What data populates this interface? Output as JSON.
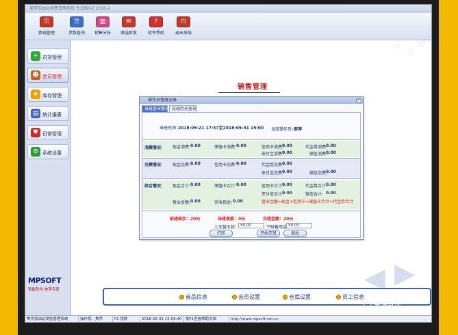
{
  "window": {
    "title": "美萍加油站销售管理系统 专业版(V) 2018-2"
  },
  "toolbar": [
    {
      "label": "换班管理",
      "icon": "key-icon",
      "color": "#c0392b"
    },
    {
      "label": "参数查询",
      "icon": "document-icon",
      "color": "#3a6fc4"
    },
    {
      "label": "销售分析",
      "icon": "chart-icon",
      "color": "#d04a8a"
    },
    {
      "label": "赠送群发",
      "icon": "gift-icon",
      "color": "#c0392b"
    },
    {
      "label": "软件帮助",
      "icon": "help-icon",
      "color": "#d03030"
    },
    {
      "label": "退出系统",
      "icon": "exit-icon",
      "color": "#c0392b"
    }
  ],
  "sidebar": {
    "items": [
      {
        "label": "进货管理",
        "icon": "plus-icon",
        "color": "#2ea83a"
      },
      {
        "label": "会员管理",
        "icon": "member-icon",
        "color": "#c86020"
      },
      {
        "label": "库存管理",
        "icon": "star-icon",
        "color": "#f0a000"
      },
      {
        "label": "统计报表",
        "icon": "report-icon",
        "color": "#4466bb"
      },
      {
        "label": "日常管理",
        "icon": "heart-icon",
        "color": "#d02a2a"
      },
      {
        "label": "系统设置",
        "icon": "gear-icon",
        "color": "#2e9a3a"
      }
    ],
    "logo": {
      "brand": "MPSOFT",
      "slogan": "智能软件 美萍专家"
    }
  },
  "main": {
    "title": "销售管理"
  },
  "dialog": {
    "title": "操作员值班记录",
    "close": "×",
    "tabs": {
      "current": "当班营业情况",
      "history": "交班历史查询"
    },
    "header": {
      "time_label": "当班时间：",
      "time_value": "2018-05-21 17:37至2018-05-31 15:00",
      "operator_label": "当班操作员：",
      "operator_value": "美萍"
    },
    "consumption": {
      "label": "消费情况：",
      "cash_label": "现金消费：",
      "cash_value": "0.00",
      "stored_label": "储值卡消费：",
      "stored_value": "0.00",
      "credit_label": "信用卡消费：",
      "credit_value": "0.00",
      "voucher_label": "代金券消费：",
      "voucher_value": "0.00",
      "alipay_label": "支付宝消费：",
      "alipay_value": "0.00",
      "wechat_label": "微信消费：",
      "wechat_value": "0.00"
    },
    "payment": {
      "label": "交费情况：",
      "cash_label": "现金交费：",
      "cash_value": "0.00",
      "credit_label": "信用卡交费：",
      "credit_value": "0.00",
      "voucher_label": "代金券交费：",
      "voucher_value": "0.00",
      "alipay_label": "支付宝交费：",
      "alipay_value": "0.00",
      "wechat_label": "微信交费：",
      "wechat_value": "0.00"
    },
    "summary": {
      "label": "综合情况：",
      "cash_label": "现金合计：",
      "cash_value": "0.00",
      "stored_label": "储值卡合计：",
      "stored_value": "0.00",
      "credit_label": "信用卡合计：",
      "credit_value": "0.00",
      "voucher_label": "代金券合计：",
      "voucher_value": "0.00",
      "alipay_label": "支付宝合计：",
      "alipay_value": "0.00",
      "wechat_label": "微信合计：",
      "wechat_value": "0.00",
      "revenue_label": "营业金额：",
      "revenue_value": "0.00",
      "actual_cash_label": "实收现金：",
      "actual_cash_value": "0.00",
      "formula": "营业金额=现金+信用卡+储值卡合计+代金券合计"
    },
    "totals": {
      "prev_cash": "前班结余：20元",
      "current_income": "当班收款：0元",
      "handover_amount": "交班金额：20元",
      "upload_label": "上交营业款：",
      "upload_value": "¥0.00",
      "reserve_label": "下缺备用金：",
      "reserve_value": "¥0.00"
    },
    "buttons": {
      "print": "打印",
      "start_handover": "开始交班",
      "exit": "退出"
    }
  },
  "bottom_bar": [
    {
      "label": "商品信息"
    },
    {
      "label": "会员设置"
    },
    {
      "label": "仓库设置"
    },
    {
      "label": "员工信息"
    }
  ],
  "statusbar": {
    "app": "美萍加油站销售管理系统",
    "operator": "操作员：美萍",
    "key": "F2 锁屏",
    "datetime": "2018-05-31 15:08:40",
    "help": "按F1查看帮助文档",
    "website": "http://www.mpsoft.net.cn"
  },
  "watermark": "美萍软件"
}
